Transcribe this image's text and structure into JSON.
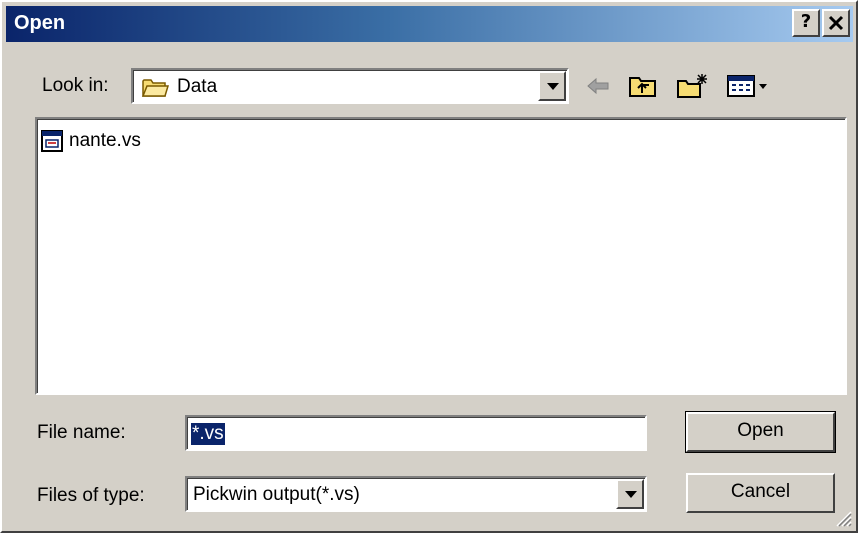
{
  "window": {
    "title": "Open",
    "help_label": "?",
    "close_label": "✕"
  },
  "lookin": {
    "label": "Look in:",
    "value": "Data",
    "icon": "folder-icon"
  },
  "toolbar": {
    "icons": [
      "back-arrow-icon",
      "up-folder-icon",
      "new-folder-icon",
      "view-menu-icon"
    ]
  },
  "files": [
    {
      "name": "nante.vs",
      "icon": "file-icon"
    }
  ],
  "filename": {
    "label": "File name:",
    "value": "*.vs"
  },
  "filetype": {
    "label": "Files of type:",
    "value": "Pickwin output(*.vs)"
  },
  "buttons": {
    "open_label": "Open",
    "cancel_label": "Cancel"
  },
  "colors": {
    "titlebar_start": "#0a246a",
    "titlebar_end": "#a6caf0",
    "face": "#d4d0c8",
    "selection": "#0a246a"
  }
}
